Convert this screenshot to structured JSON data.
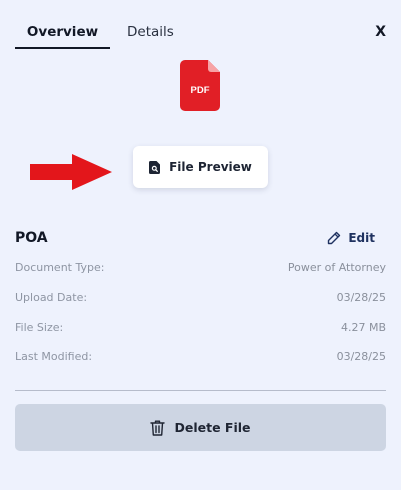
{
  "tabs": [
    {
      "label": "Overview",
      "active": true
    },
    {
      "label": "Details",
      "active": false
    }
  ],
  "close_label": "X",
  "file_icon": {
    "icon": "pdf-file-icon",
    "text": "PDF",
    "color": "#e11f26"
  },
  "pointer_arrow": {
    "icon": "arrow-right-icon",
    "color": "#e3161b"
  },
  "preview_button": {
    "label": "File Preview",
    "icon": "file-search-icon"
  },
  "document": {
    "title": "POA",
    "edit_label": "Edit",
    "edit_icon": "pencil-icon",
    "fields": [
      {
        "label": "Document Type:",
        "value": "Power of Attorney"
      },
      {
        "label": "Upload Date:",
        "value": "03/28/25"
      },
      {
        "label": "File Size:",
        "value": "4.27 MB"
      },
      {
        "label": "Last Modified:",
        "value": "03/28/25"
      }
    ]
  },
  "delete_button": {
    "label": "Delete File",
    "icon": "trash-icon"
  }
}
